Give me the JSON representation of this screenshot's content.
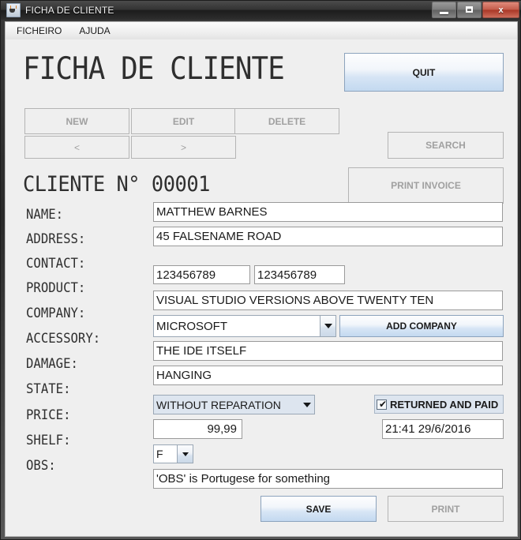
{
  "window": {
    "title": "FICHA DE CLIENTE",
    "icon": "java-coffee-cup-icon",
    "minimize_label": "",
    "maximize_label": "",
    "close_label": "x"
  },
  "menubar": {
    "items": [
      {
        "label": "FICHEIRO"
      },
      {
        "label": "AJUDA"
      }
    ]
  },
  "heading": {
    "title": "FICHA DE CLIENTE",
    "client_number": "CLIENTE N° 00001"
  },
  "toolbar": {
    "quit_label": "QUIT",
    "new_label": "NEW",
    "edit_label": "EDIT",
    "delete_label": "DELETE",
    "prev_label": "<",
    "next_label": ">",
    "search_label": "SEARCH",
    "print_invoice_label": "PRINT INVOICE"
  },
  "form": {
    "name": {
      "label": "NAME:",
      "value": "MATTHEW BARNES"
    },
    "address": {
      "label": "ADDRESS:",
      "value": "45 FALSENAME ROAD"
    },
    "contact": {
      "label": "CONTACT:",
      "value1": "123456789",
      "value2": "123456789"
    },
    "product": {
      "label": "PRODUCT:",
      "value": "VISUAL STUDIO VERSIONS ABOVE TWENTY TEN"
    },
    "company": {
      "label": "COMPANY:",
      "value": "MICROSOFT",
      "add_button_label": "ADD COMPANY"
    },
    "accessory": {
      "label": "ACCESSORY:",
      "value": "THE IDE ITSELF"
    },
    "damage": {
      "label": "DAMAGE:",
      "value": "HANGING"
    },
    "state": {
      "label": "STATE:",
      "value": "WITHOUT REPARATION"
    },
    "returned_and_paid": {
      "label": "RETURNED AND PAID",
      "checked_glyph": "✔"
    },
    "price": {
      "label": "PRICE:",
      "value": "99,99"
    },
    "datetime": {
      "value": "21:41 29/6/2016"
    },
    "shelf": {
      "label": "SHELF:",
      "value": "F"
    },
    "obs": {
      "label": "OBS:",
      "value": "'OBS' is Portugese for something"
    }
  },
  "footer": {
    "save_label": "SAVE",
    "print_label": "PRINT"
  },
  "colors": {
    "panel_bg": "#efefef",
    "enabled_button_accent": "#c3d9f0",
    "disabled_text": "#a0a0a0",
    "combo_readonly_bg": "#dde5ef",
    "close_button": "#a83726"
  }
}
